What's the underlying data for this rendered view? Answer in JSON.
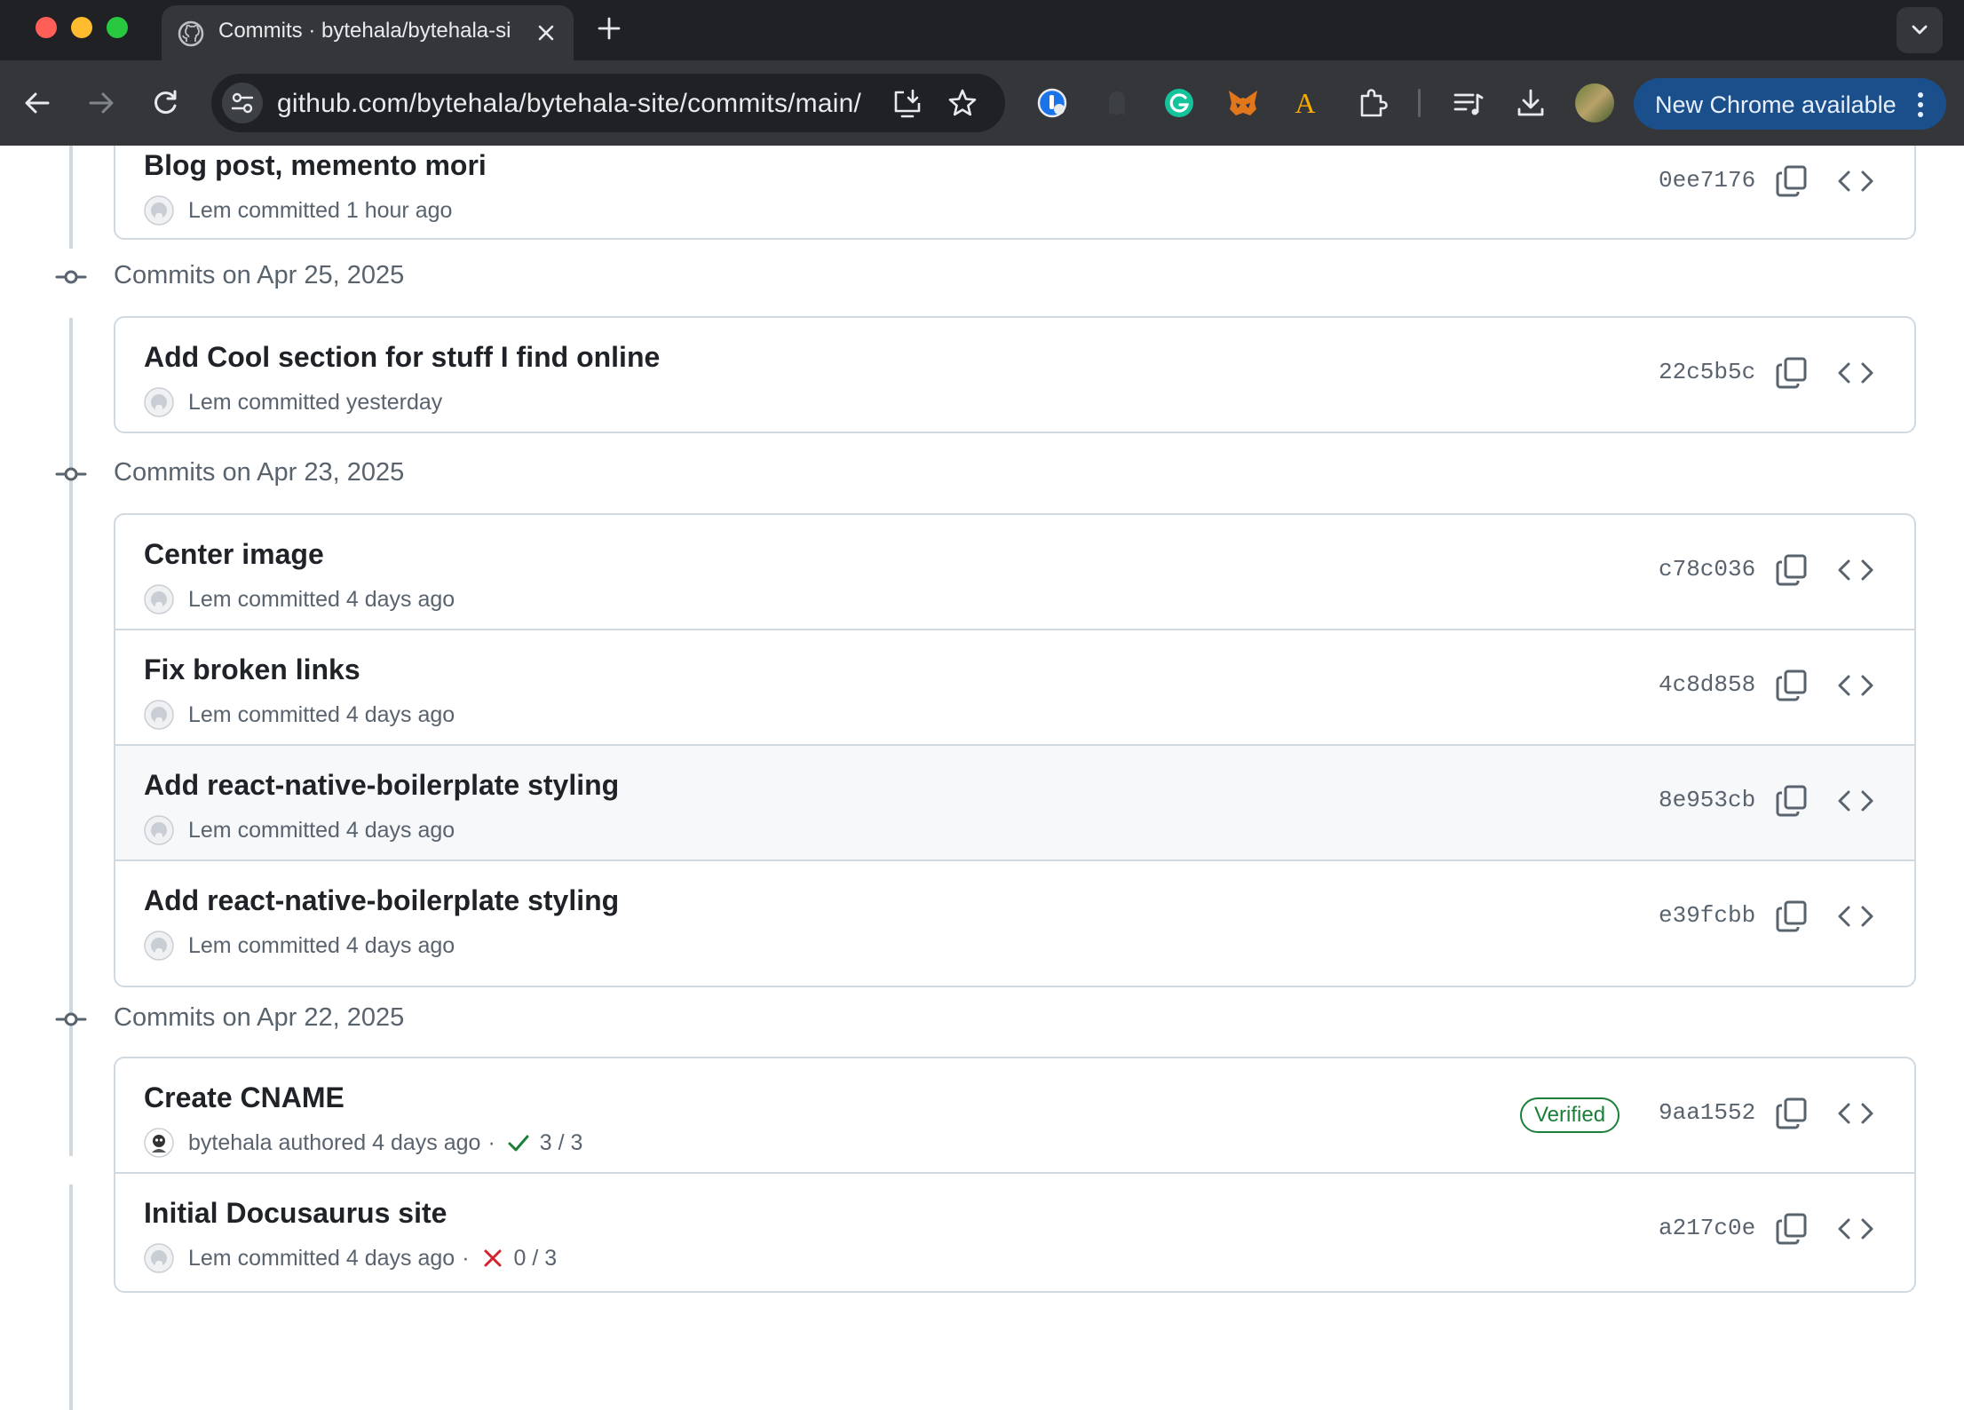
{
  "browser": {
    "tab_title": "Commits · bytehala/bytehala-site",
    "url": "github.com/bytehala/bytehala-site/commits/main/",
    "update_button_label": "New Chrome available"
  },
  "commits": {
    "top_commit": {
      "title": "Blog post, memento mori",
      "author": "Lem",
      "action": "committed",
      "time": "1 hour ago",
      "sha": "0ee7176"
    },
    "groups": [
      {
        "date_label": "Commits on Apr 25, 2025",
        "items": [
          {
            "title": "Add Cool section for stuff I find online",
            "author": "Lem",
            "action": "committed",
            "time": "yesterday",
            "sha": "22c5b5c"
          }
        ]
      },
      {
        "date_label": "Commits on Apr 23, 2025",
        "items": [
          {
            "title": "Center image",
            "author": "Lem",
            "action": "committed",
            "time": "4 days ago",
            "sha": "c78c036"
          },
          {
            "title": "Fix broken links",
            "author": "Lem",
            "action": "committed",
            "time": "4 days ago",
            "sha": "4c8d858"
          },
          {
            "title": "Add react-native-boilerplate styling",
            "author": "Lem",
            "action": "committed",
            "time": "4 days ago",
            "sha": "8e953cb"
          },
          {
            "title": "Add react-native-boilerplate styling",
            "author": "Lem",
            "action": "committed",
            "time": "4 days ago",
            "sha": "e39fcbb"
          }
        ]
      },
      {
        "date_label": "Commits on Apr 22, 2025",
        "items": [
          {
            "title": "Create CNAME",
            "author": "bytehala",
            "action": "authored",
            "time": "4 days ago",
            "separator": "·",
            "checks": "3 / 3",
            "check_status": "success",
            "verified_label": "Verified",
            "sha": "9aa1552"
          },
          {
            "title": "Initial Docusaurus site",
            "author": "Lem",
            "action": "committed",
            "time": "4 days ago",
            "separator": "·",
            "checks": "0 / 3",
            "check_status": "failure",
            "sha": "a217c0e"
          }
        ]
      }
    ]
  },
  "icons": {
    "copy": "copy-icon",
    "browse": "code-icon",
    "commit_group": "git-commit-icon",
    "check_success": "check-icon",
    "check_failure": "x-icon"
  },
  "colors": {
    "success": "#1a7f37",
    "failure": "#d1242f",
    "muted": "#59636e",
    "border": "#d1d9e0"
  }
}
